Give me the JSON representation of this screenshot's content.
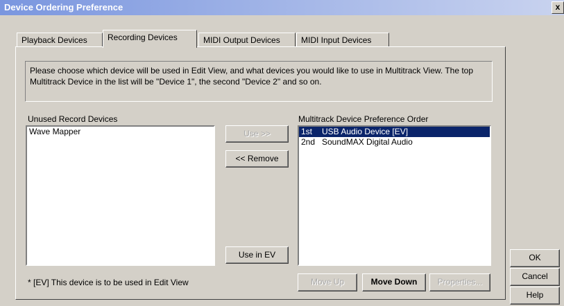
{
  "window": {
    "title": "Device Ordering Preference",
    "close_glyph": "x"
  },
  "tabs": [
    {
      "label": "Playback Devices"
    },
    {
      "label": "Recording Devices"
    },
    {
      "label": "MIDI Output Devices"
    },
    {
      "label": "MIDI Input Devices"
    }
  ],
  "info_text": "Please choose which device will be used in Edit View, and what devices you would like to use in Multitrack View.  The top Multitrack Device in the list will be \"Device 1\", the second \"Device 2\" and so on.",
  "unused": {
    "label": "Unused Record Devices",
    "items": [
      {
        "label": "Wave Mapper"
      }
    ]
  },
  "multitrack": {
    "label": "Multitrack Device Preference Order",
    "items": [
      {
        "rank": "1st",
        "label": "USB Audio Device [EV]",
        "selected": true
      },
      {
        "rank": "2nd",
        "label": "SoundMAX Digital Audio",
        "selected": false
      }
    ]
  },
  "buttons": {
    "use": "Use >>",
    "remove": "<< Remove",
    "use_in_ev": "Use in EV",
    "move_up": "Move Up",
    "move_down": "Move Down",
    "properties": "Properties...",
    "ok": "OK",
    "cancel": "Cancel",
    "help": "Help"
  },
  "footnote": "* [EV] This device is to be used in Edit View"
}
